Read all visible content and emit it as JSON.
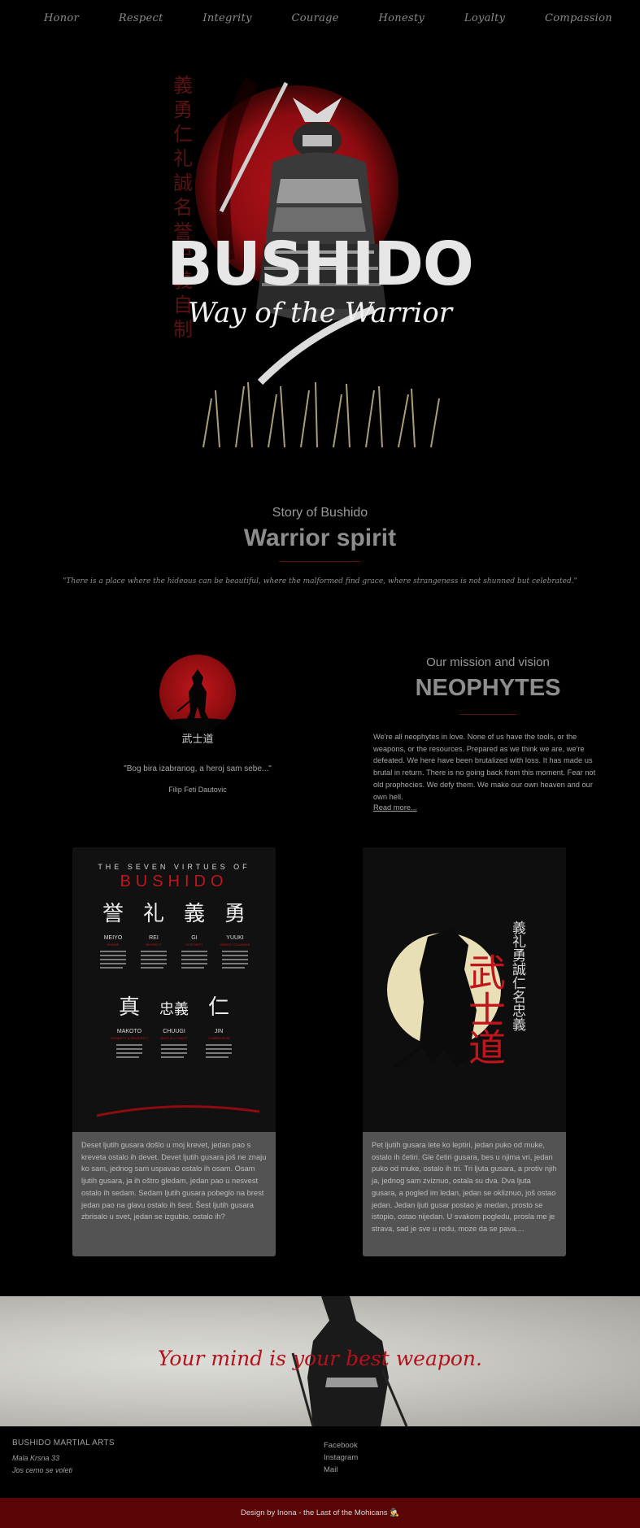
{
  "nav": {
    "items": [
      {
        "label": "Honor"
      },
      {
        "label": "Respect"
      },
      {
        "label": "Integrity"
      },
      {
        "label": "Courage"
      },
      {
        "label": "Honesty"
      },
      {
        "label": "Loyalty"
      },
      {
        "label": "Compassion"
      }
    ]
  },
  "hero": {
    "kanji": [
      "義",
      "勇",
      "仁",
      "礼",
      "誠",
      "名",
      "誉",
      "忠",
      "義",
      "自",
      "制"
    ],
    "title": "BUSHIDO",
    "subtitle": "Way of the Warrior"
  },
  "story": {
    "kicker": "Story of Bushido",
    "title": "Warrior spirit",
    "quote": "\"There is a place where the hideous can be beautiful, where the malformed find grace, where strangeness is not shunned but celebrated.\""
  },
  "left_panel": {
    "emblem_kanji": "武士道",
    "quote": "\"Bog bira izabranog, a heroj sam sebe...\"",
    "author": "Filip Feti Dautovic"
  },
  "mission": {
    "kicker": "Our mission and vision",
    "title": "NEOPHYTES",
    "text": "We're all neophytes in love. None of us have the tools, or the weapons, or the resources. Prepared as we think we are, we're defeated. We here have been brutalized with loss. It has made us brutal in return. There is no going back from this moment. Fear not old prophecies. We defy them. We make our own heaven and our own hell.",
    "read_more": "Read more..."
  },
  "cards": [
    {
      "poster": {
        "top": "THE SEVEN VIRTUES OF",
        "title": "BUSHIDO",
        "virtues": [
          {
            "kanji": "誉",
            "name": "MEIYO",
            "meaning": "HONOR"
          },
          {
            "kanji": "礼",
            "name": "REI",
            "meaning": "RESPECT"
          },
          {
            "kanji": "義",
            "name": "GI",
            "meaning": "INTEGRITY"
          },
          {
            "kanji": "勇",
            "name": "YUUKI",
            "meaning": "HEROIC COURAGE"
          },
          {
            "kanji": "真",
            "name": "MAKOTO",
            "meaning": "HONESTY & SINCERITY"
          },
          {
            "kanji": "忠義",
            "name": "CHUUGI",
            "meaning": "DUTY & LOYALTY"
          },
          {
            "kanji": "仁",
            "name": "JIN",
            "meaning": "COMPASSION"
          }
        ]
      },
      "text": "Deset ljutih gusara došlo u moj krevet, jedan pao s kreveta ostalo ih devet. Devet ljutih gusara još ne znaju ko sam, jednog sam uspavao ostalo ih osam. Osam ljutih gusara, ja ih oštro gledam, jedan pao u nesvest ostalo ih sedam. Sedam ljutih gusara pobeglo na brest jedan pao na glavu ostalo ih šest. Šest ljutih gusara zbrisalo u svet, jedan se izgubio, ostalo ih?"
    },
    {
      "side_kanji": "義礼勇誠仁名忠義",
      "red_kanji": "武士道",
      "text": "Pet ljutih gusara lete ko leptiri, jedan pukо od muke, ostalo ih četiri. Gle četiri gusara, bes u njima vri, jedan pukо od muke, ostalo ih tri. Tri ljuta gusara, a protiv njih ja, jednog sam zviznuo, ostala su dva. Dva ljuta gusara, a pogled im ledan, jedan se okliznuo, još ostao jedan. Jedan ljuti gusar postao je medan, prosto se istopio, ostao nijedan. U svakom pogledu, prosla me je strava, sad je sve u redu, moze da se pava...."
    }
  ],
  "banner": {
    "text": "Your mind is your best weapon."
  },
  "footer": {
    "title": "BUSHIDO MARTIAL ARTS",
    "address_line1": "Mala Krsna 33",
    "address_line2": "Jos cemo se voleti",
    "links": [
      {
        "label": "Facebook"
      },
      {
        "label": "Instagram"
      },
      {
        "label": "Mail"
      }
    ],
    "credit": "Design by Inona - the Last of the Mohicans 🕵"
  },
  "colors": {
    "accent_red": "#b4121b",
    "bottom_bar": "#5a0606",
    "card_bg": "#535353"
  }
}
